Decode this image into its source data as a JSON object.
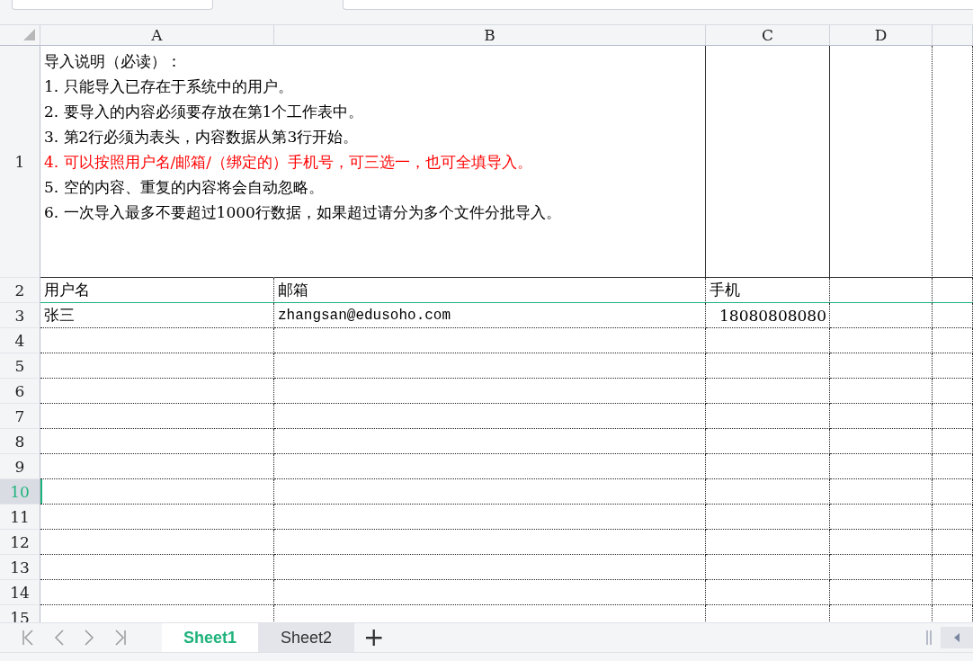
{
  "columns": [
    {
      "label": "A"
    },
    {
      "label": "B"
    },
    {
      "label": "C"
    },
    {
      "label": "D"
    }
  ],
  "rows": [
    {
      "number": "1",
      "selected": false,
      "notes": [
        {
          "text": "导入说明（必读）：",
          "color": "#000000"
        },
        {
          "text": "1.  只能导入已存在于系统中的用户。",
          "color": "#000000"
        },
        {
          "text": "2.  要导入的内容必须要存放在第1个工作表中。",
          "color": "#000000"
        },
        {
          "text": "3.  第2行必须为表头，内容数据从第3行开始。",
          "color": "#000000"
        },
        {
          "text": "4.  可以按照用户名/邮箱/（绑定的）手机号，可三选一，也可全填导入。",
          "color": "#ff0000"
        },
        {
          "text": "5.  空的内容、重复的内容将会自动忽略。",
          "color": "#000000"
        },
        {
          "text": "6.  一次导入最多不要超过1000行数据，如果超过请分为多个文件分批导入。",
          "color": "#000000"
        }
      ]
    },
    {
      "number": "2",
      "selected": false,
      "a": "用户名",
      "b": "邮箱",
      "c": "手机"
    },
    {
      "number": "3",
      "selected": false,
      "a": "张三",
      "b": "zhangsan@edusoho.com",
      "c": "18080808080"
    },
    {
      "number": "4",
      "selected": false
    },
    {
      "number": "5",
      "selected": false
    },
    {
      "number": "6",
      "selected": false
    },
    {
      "number": "7",
      "selected": false
    },
    {
      "number": "8",
      "selected": false
    },
    {
      "number": "9",
      "selected": false
    },
    {
      "number": "10",
      "selected": true
    },
    {
      "number": "11",
      "selected": false
    },
    {
      "number": "12",
      "selected": false
    },
    {
      "number": "13",
      "selected": false
    },
    {
      "number": "14",
      "selected": false
    },
    {
      "number": "15",
      "selected": false
    }
  ],
  "sheets": [
    {
      "label": "Sheet1",
      "selected": true
    },
    {
      "label": "Sheet2",
      "selected": false
    }
  ],
  "add_sheet": "+"
}
